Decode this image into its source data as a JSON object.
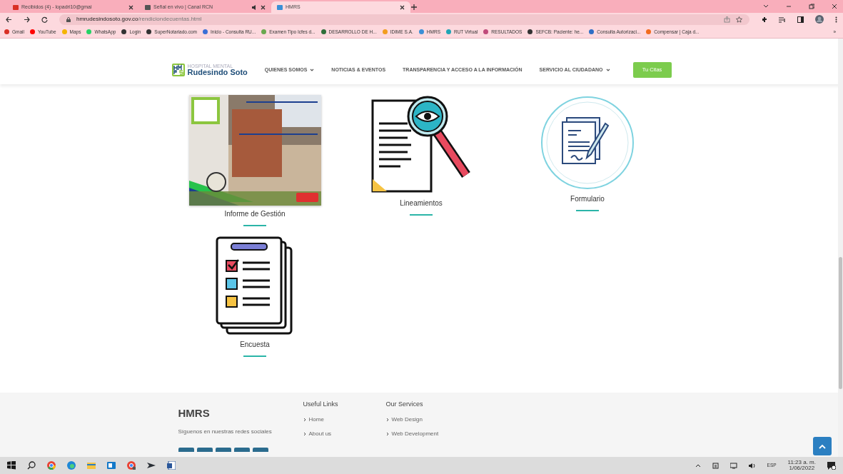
{
  "browser": {
    "tabs": [
      {
        "title": "Recibidos (4) - lopadri10@gmai",
        "selected": false,
        "audio": false,
        "color": "#d93025"
      },
      {
        "title": "Señal en vivo | Canal RCN",
        "selected": false,
        "audio": true,
        "color": "#555555"
      },
      {
        "title": "HMRS",
        "selected": true,
        "audio": false,
        "color": "#3b8fd6"
      }
    ],
    "address": {
      "host": "hmrudesindosoto.gov.co",
      "path": "/rendiciondecuentas.html"
    },
    "bookmarks": [
      {
        "label": "Gmail",
        "color": "#d93025"
      },
      {
        "label": "YouTube",
        "color": "#ff0000"
      },
      {
        "label": "Maps",
        "color": "#f4b400"
      },
      {
        "label": "WhatsApp",
        "color": "#25d366"
      },
      {
        "label": "Login",
        "color": "#333333"
      },
      {
        "label": "SuperNotariado.com",
        "color": "#333333"
      },
      {
        "label": "Inicio - Consulta RU...",
        "color": "#3b6fd6"
      },
      {
        "label": "Examen Tipo Icfes d...",
        "color": "#6aa84f"
      },
      {
        "label": "DESARROLLO DE H...",
        "color": "#2f6f3a"
      },
      {
        "label": "IDIME S.A.",
        "color": "#f29d1e"
      },
      {
        "label": "HMRS",
        "color": "#3b8fd6"
      },
      {
        "label": "RUT Virtual",
        "color": "#21a5b5"
      },
      {
        "label": "RESULTADOS",
        "color": "#c04a7a"
      },
      {
        "label": "SEFCB: Paciente: he...",
        "color": "#333333"
      },
      {
        "label": "Consulta Autorizaci...",
        "color": "#2f6fc6"
      },
      {
        "label": "Compensar | Caja d...",
        "color": "#f26b1d"
      }
    ],
    "bookmarks_more": "»"
  },
  "site": {
    "logo": {
      "top": "HOSPITAL MENTAL",
      "bottom": "Rudesindo Soto"
    },
    "nav": [
      {
        "label": "QUIENES SOMOS",
        "dropdown": true
      },
      {
        "label": "NOTICIAS & EVENTOS",
        "dropdown": false
      },
      {
        "label": "TRANSPARENCIA Y ACCESO A LA INFORMACIÓN",
        "dropdown": false
      },
      {
        "label": "SERVICIO AL CIUDADANO",
        "dropdown": true
      }
    ],
    "cta": "Tu Citas",
    "items": [
      {
        "label": "Informe de Gestión",
        "kind": "poster"
      },
      {
        "label": "Lineamientos",
        "kind": "inspect"
      },
      {
        "label": "Formulario",
        "kind": "form"
      },
      {
        "label": "Encuesta",
        "kind": "survey"
      }
    ],
    "footer": {
      "brand": "HMRS",
      "tagline": "Síguenos en nuestras redes sociales",
      "columns": [
        {
          "title": "Useful Links",
          "links": [
            "Home",
            "About us"
          ]
        },
        {
          "title": "Our Services",
          "links": [
            "Web Design",
            "Web Development"
          ]
        }
      ]
    }
  },
  "taskbar": {
    "language": "ESP",
    "time": "11:23 a. m.",
    "date": "1/06/2022"
  }
}
